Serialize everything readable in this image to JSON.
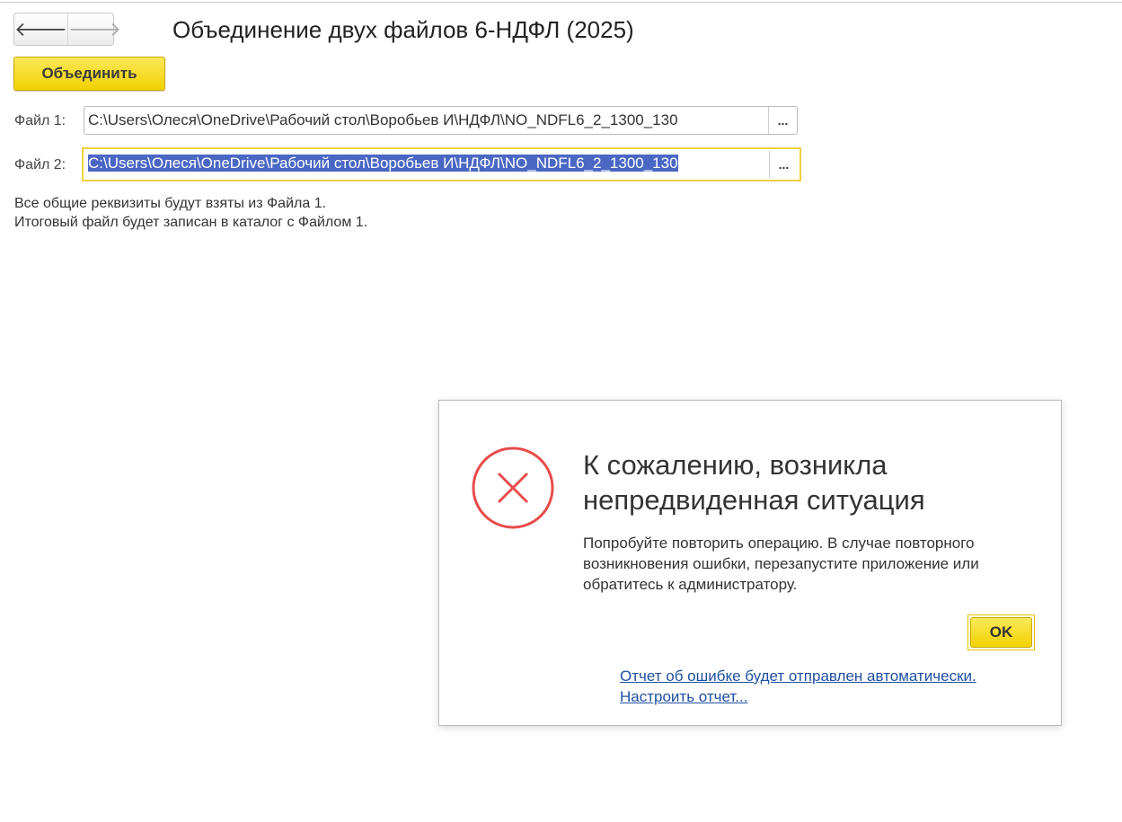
{
  "header": {
    "back": "🡐",
    "forward": "🡒",
    "title": "Объединение двух файлов 6-НДФЛ (2025)"
  },
  "toolbar": {
    "merge_label": "Объединить"
  },
  "form": {
    "file1_label": "Файл 1:",
    "file1_value": "C:\\Users\\Олеся\\OneDrive\\Рабочий стол\\Воробьев И\\НДФЛ\\NO_NDFL6_2_1300_130",
    "file2_label": "Файл 2:",
    "file2_value": "C:\\Users\\Олеся\\OneDrive\\Рабочий стол\\Воробьев И\\НДФЛ\\NO_NDFL6_2_1300_130",
    "browse": "...",
    "note1": "Все общие реквизиты будут взяты из Файла 1.",
    "note2": "Итоговый файл будет записан в каталог с Файлом 1."
  },
  "dialog": {
    "title_line1": "К сожалению, возникла",
    "title_line2": "непредвиденная ситуация",
    "message": "Попробуйте повторить операцию. В случае повторного возникновения ошибки, перезапустите приложение или обратитесь к администратору.",
    "ok": "OK",
    "link1": "Отчет об ошибке будет отправлен автоматически.",
    "link2": "Настроить отчет...",
    "error_color": "#e84c4c"
  }
}
